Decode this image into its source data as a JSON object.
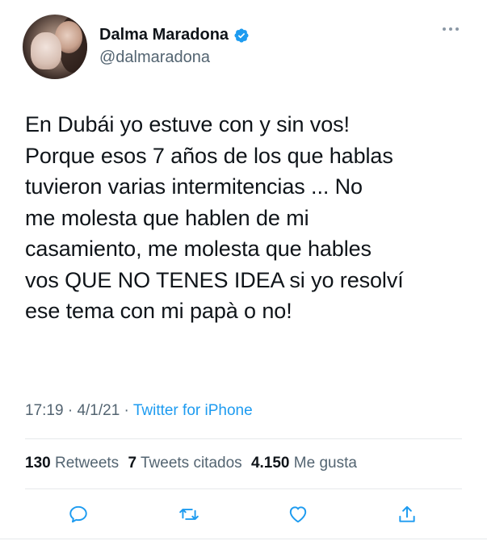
{
  "user": {
    "display_name": "Dalma Maradona",
    "handle": "@dalmaradona",
    "verified": true
  },
  "tweet": {
    "text": "En Dubái yo estuve con y sin vos!\nPorque esos 7 años de los que hablas\ntuvieron varias intermitencias ...  No\nme molesta que hablen de mi\ncasamiento, me molesta que hables\nvos QUE NO TENES IDEA si yo resolví\nese tema con mi papà o no!",
    "time": "17:19",
    "date": "4/1/21",
    "separator": "·",
    "source": "Twitter for iPhone"
  },
  "stats": {
    "retweets_count": "130",
    "retweets_label": "Retweets",
    "quotes_count": "7",
    "quotes_label": "Tweets citados",
    "likes_count": "4.150",
    "likes_label": "Me gusta"
  },
  "actions": {
    "reply_icon": "speech-bubble-icon",
    "retweet_icon": "retweet-arrows-icon",
    "like_icon": "heart-icon",
    "share_icon": "share-upload-icon"
  },
  "colors": {
    "accent": "#1d9bf0",
    "text": "#0f1419",
    "secondary": "#536471",
    "divider": "#e6e9eb"
  }
}
